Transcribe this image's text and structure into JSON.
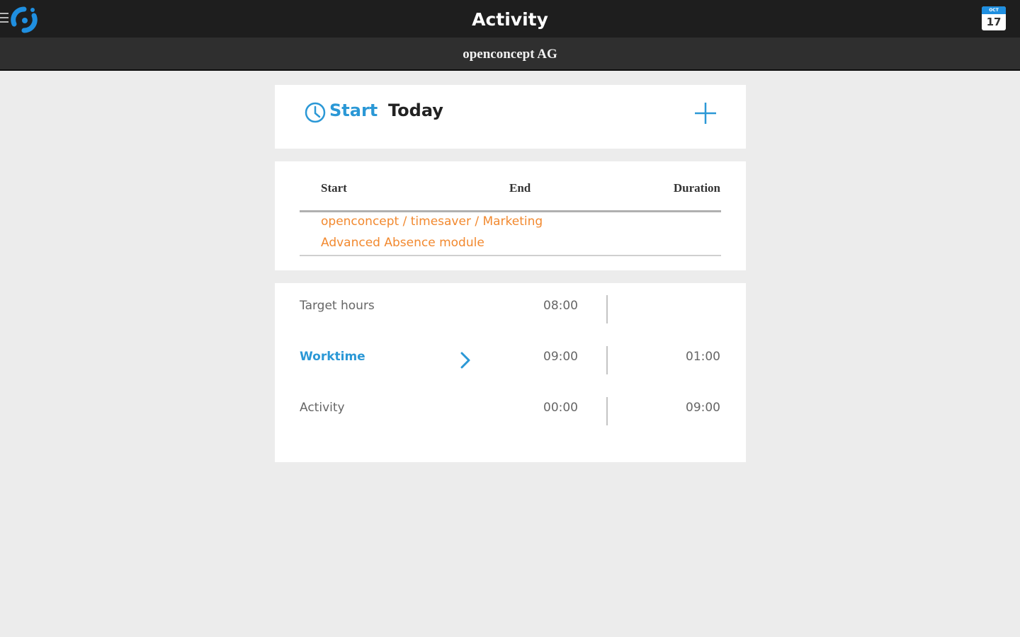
{
  "header": {
    "title": "Activity",
    "company": "openconcept AG",
    "calendar_day": "17",
    "calendar_month": "OCT"
  },
  "start_card": {
    "start_label": "Start",
    "date_label": "Today"
  },
  "entries": {
    "columns": [
      "Start",
      "End",
      "Duration"
    ],
    "rows": [
      {
        "path": "openconcept / timesaver / Marketing",
        "task": "Advanced Absence module"
      }
    ]
  },
  "summary": {
    "rows": [
      {
        "label": "Target hours",
        "value": "08:00",
        "diff": ""
      },
      {
        "label": "Worktime",
        "value": "09:00",
        "diff": "01:00"
      },
      {
        "label": "Activity",
        "value": "00:00",
        "diff": "09:00"
      }
    ]
  },
  "colors": {
    "accent": "#2b98d6",
    "entry_text": "#f2892f",
    "topbar": "#1e1e1e",
    "background": "#ececec"
  },
  "icons": [
    "menu-icon",
    "app-logo-icon",
    "calendar-icon",
    "clock-icon",
    "plus-icon",
    "chevron-right-icon"
  ]
}
